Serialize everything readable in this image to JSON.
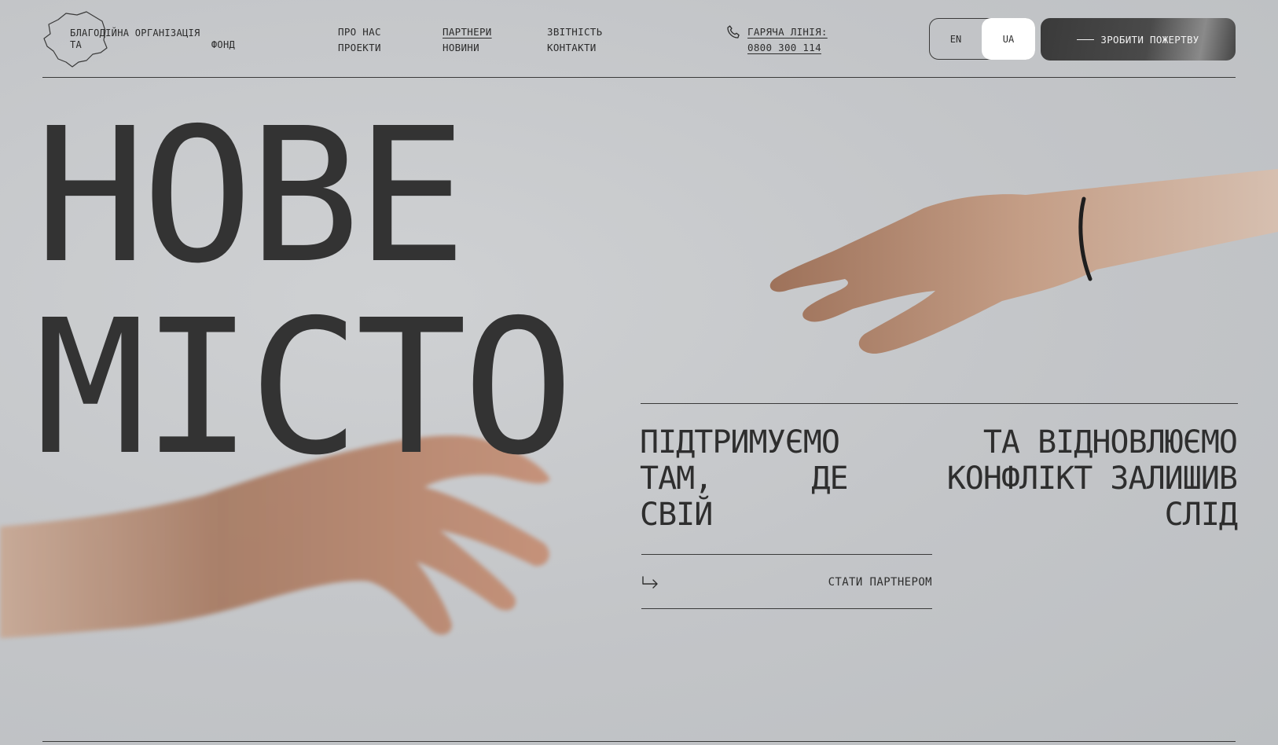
{
  "header": {
    "logo": {
      "line1": "БЛАГОДІЙНА ОРГАНІЗАЦІЯ",
      "line2_left": "ТА",
      "line2_right": "ФОНД"
    },
    "nav": {
      "col1": [
        "ПРО НАС",
        "ПРОЕКТИ"
      ],
      "col2": [
        "ПАРТНЕРИ",
        "НОВИНИ"
      ],
      "col3": [
        "ЗВІТНІСТЬ",
        "КОНТАКТИ"
      ]
    },
    "hotline": {
      "label": "ГАРЯЧА ЛІНІЯ:",
      "number": "0800 300 114"
    },
    "lang": {
      "en": "EN",
      "ua": "UA",
      "active": "UA"
    },
    "donate_label": "ЗРОБИТИ ПОЖЕРТВУ"
  },
  "hero": {
    "line1": "НОВЕ",
    "line2": "МІСТО"
  },
  "tagline": {
    "row1": [
      "ПІДТРИМУЄМО",
      "ТА ВІДНОВЛЮЄМО"
    ],
    "row2": [
      "ТАМ,",
      "ДЕ",
      "КОНФЛІКТ ЗАЛИШИВ"
    ],
    "row3": [
      "СВІЙ",
      "СЛІД"
    ]
  },
  "cta_label": "СТАТИ ПАРТНЕРОМ",
  "icons": [
    "map-outline-icon",
    "phone-icon",
    "return-arrow-icon"
  ],
  "colors": {
    "background": "#c4c6c8",
    "text": "#2e2e2e",
    "donate_bg": "#3a3a3a",
    "active_lang_bg": "#ffffff"
  }
}
